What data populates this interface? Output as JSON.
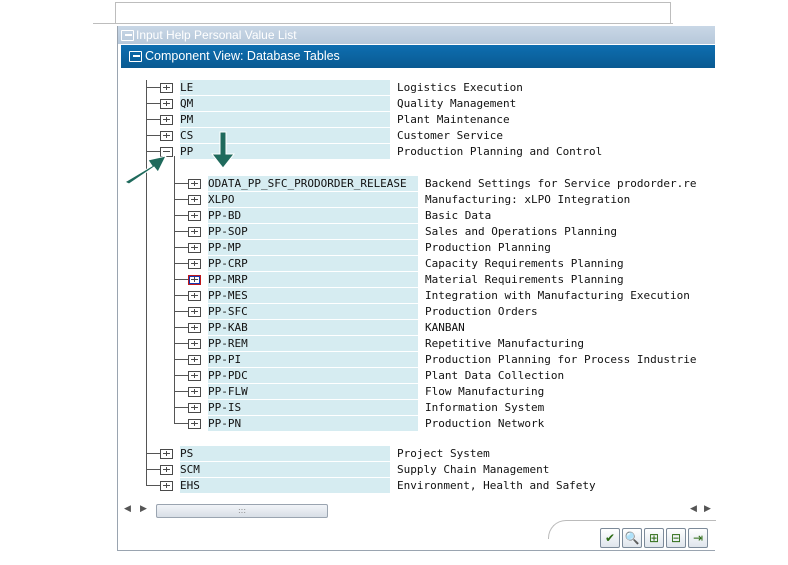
{
  "window": {
    "outer_title": "Input Help Personal Value List",
    "inner_title": "Component View: Database Tables"
  },
  "tree": {
    "top_items": [
      {
        "code": "LE",
        "desc": "Logistics Execution"
      },
      {
        "code": "QM",
        "desc": "Quality Management"
      },
      {
        "code": "PM",
        "desc": "Plant Maintenance"
      },
      {
        "code": "CS",
        "desc": "Customer Service"
      },
      {
        "code": "PP",
        "desc": "Production Planning and Control"
      }
    ],
    "pp_children": [
      {
        "code": "ODATA_PP_SFC_PRODORDER_RELEASE",
        "desc": "Backend Settings for Service prodorder.re"
      },
      {
        "code": "XLPO",
        "desc": "Manufacturing: xLPO Integration"
      },
      {
        "code": "PP-BD",
        "desc": "Basic Data"
      },
      {
        "code": "PP-SOP",
        "desc": "Sales and Operations Planning"
      },
      {
        "code": "PP-MP",
        "desc": "Production Planning"
      },
      {
        "code": "PP-CRP",
        "desc": "Capacity Requirements Planning"
      },
      {
        "code": "PP-MRP",
        "desc": "Material Requirements Planning"
      },
      {
        "code": "PP-MES",
        "desc": "Integration with Manufacturing Execution"
      },
      {
        "code": "PP-SFC",
        "desc": "Production Orders"
      },
      {
        "code": "PP-KAB",
        "desc": "KANBAN"
      },
      {
        "code": "PP-REM",
        "desc": "Repetitive Manufacturing"
      },
      {
        "code": "PP-PI",
        "desc": "Production Planning for Process Industrie"
      },
      {
        "code": "PP-PDC",
        "desc": "Plant Data Collection"
      },
      {
        "code": "PP-FLW",
        "desc": "Flow Manufacturing"
      },
      {
        "code": "PP-IS",
        "desc": "Information System"
      },
      {
        "code": "PP-PN",
        "desc": "Production Network"
      }
    ],
    "bottom_items": [
      {
        "code": "PS",
        "desc": "Project System"
      },
      {
        "code": "SCM",
        "desc": "Supply Chain Management"
      },
      {
        "code": "EHS",
        "desc": "Environment, Health and Safety"
      }
    ],
    "selected_child_index": 6
  },
  "scrollbar": {
    "thumb_grip": ":::"
  },
  "footer_buttons": [
    {
      "name": "confirm-button",
      "icon": "check-icon",
      "glyph": "✔"
    },
    {
      "name": "find-button",
      "icon": "search-icon",
      "glyph": "🔍"
    },
    {
      "name": "expand-button",
      "icon": "expand-subtree-icon",
      "glyph": "⊞"
    },
    {
      "name": "collapse-button",
      "icon": "collapse-subtree-icon",
      "glyph": "⊟"
    },
    {
      "name": "choose-button",
      "icon": "choose-icon",
      "glyph": "⇥"
    }
  ],
  "colors": {
    "inner_title_bg": "#0e6eb0",
    "code_highlight": "#d6ecf1",
    "annotation_arrow": "#1f6a5c"
  }
}
